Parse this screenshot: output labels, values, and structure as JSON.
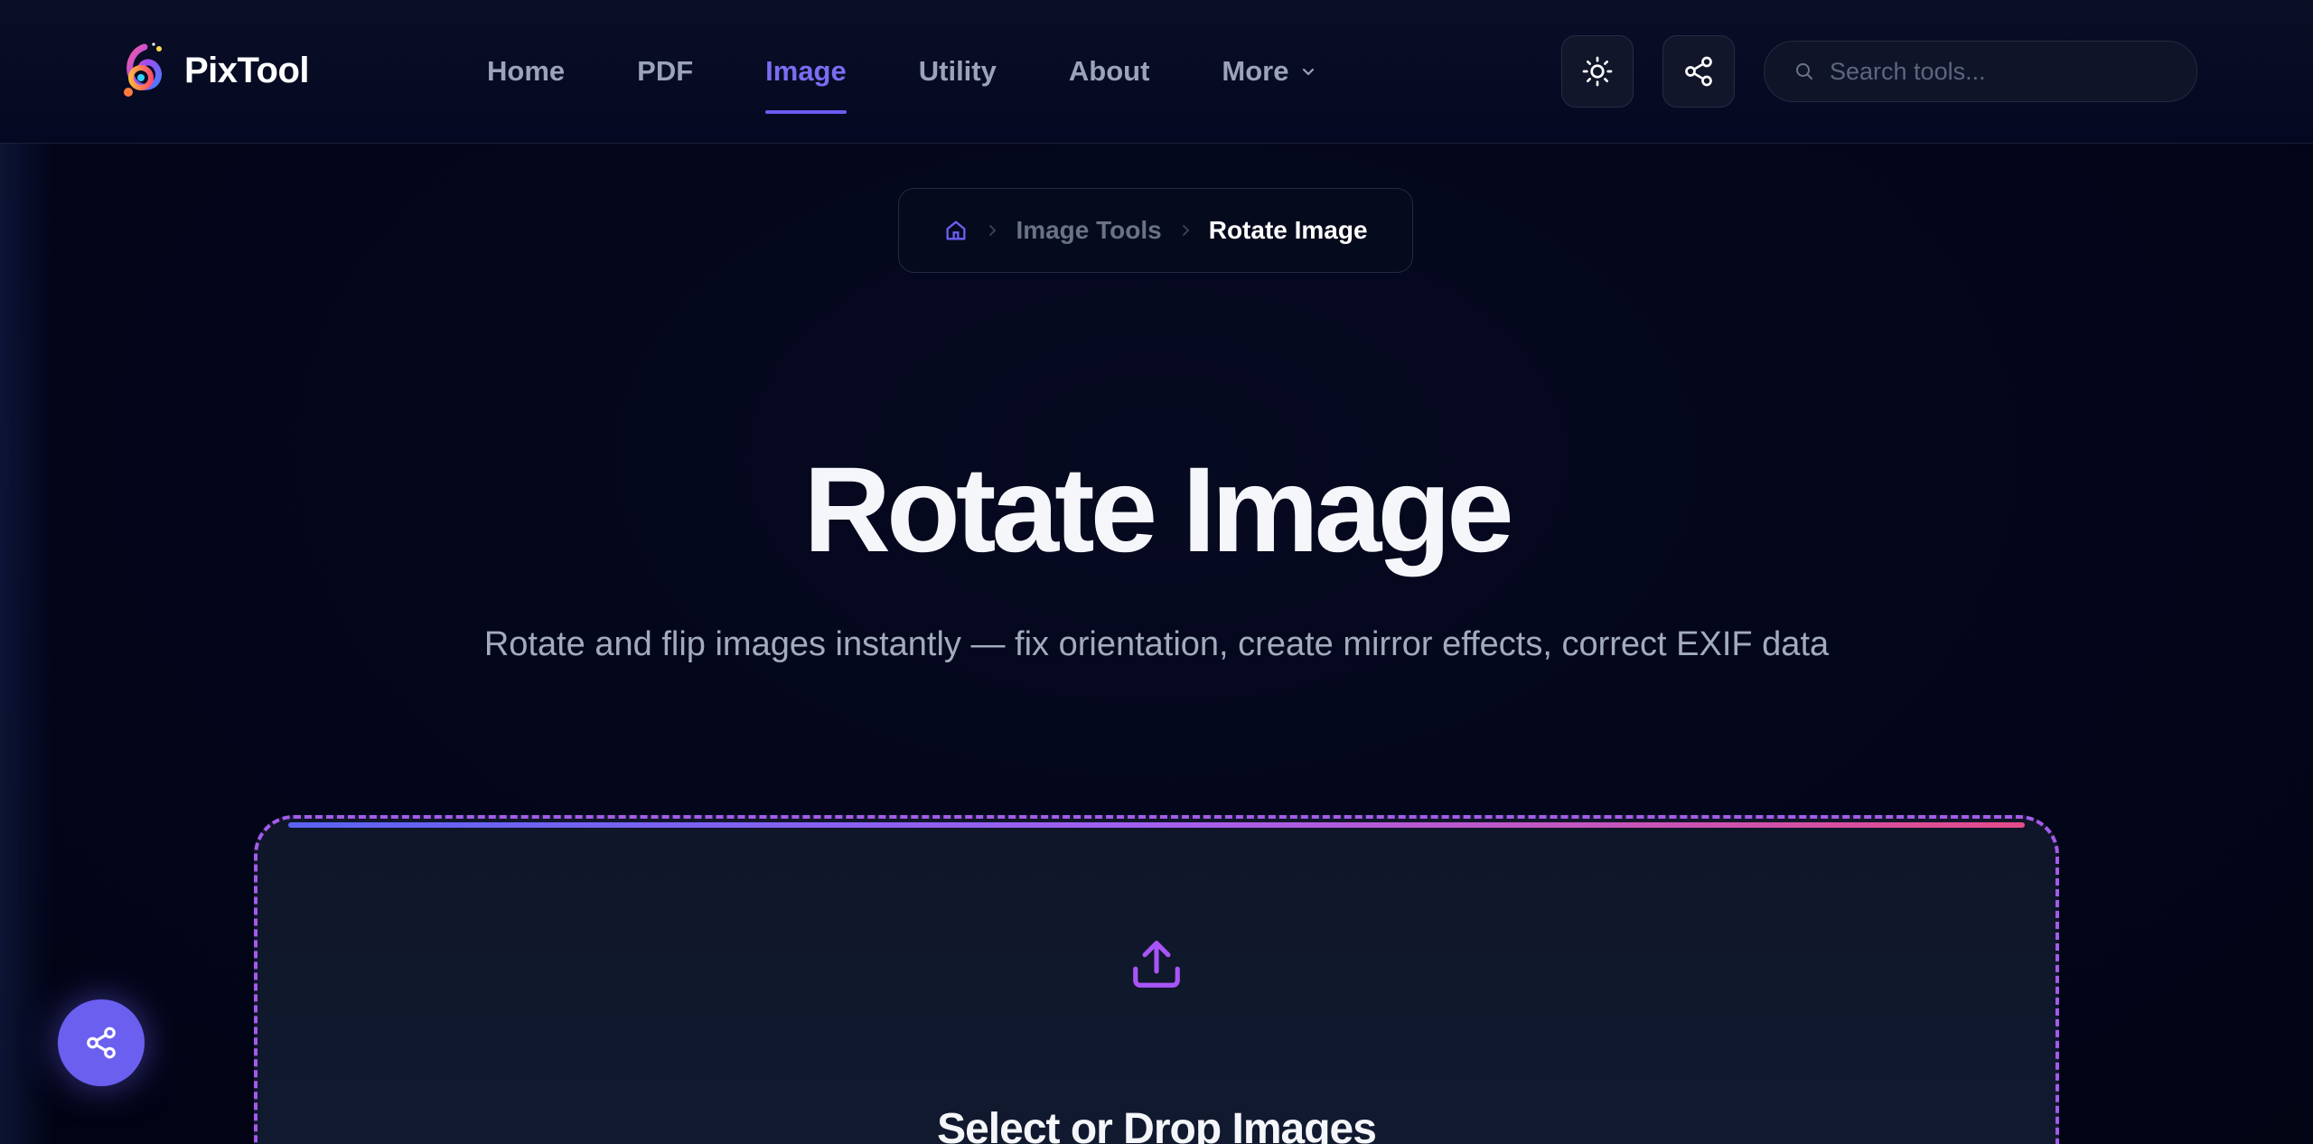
{
  "brand": {
    "name": "PixTool"
  },
  "nav": {
    "items": [
      {
        "label": "Home",
        "active": false
      },
      {
        "label": "PDF",
        "active": false
      },
      {
        "label": "Image",
        "active": true
      },
      {
        "label": "Utility",
        "active": false
      },
      {
        "label": "About",
        "active": false
      },
      {
        "label": "More",
        "active": false,
        "has_dropdown": true
      }
    ]
  },
  "header": {
    "theme_toggle_icon": "sun-icon",
    "share_icon": "share-icon",
    "search_placeholder": "Search tools..."
  },
  "breadcrumb": {
    "home_icon": "home-icon",
    "parent": "Image Tools",
    "current": "Rotate Image"
  },
  "hero": {
    "title": "Rotate Image",
    "subtitle": "Rotate and flip images instantly — fix orientation, create mirror effects, correct EXIF data"
  },
  "dropzone": {
    "icon": "upload-icon",
    "title": "Select or Drop Images"
  },
  "colors": {
    "accent": "#6b5ff0",
    "active_nav": "#7c6cf2",
    "dropzone_border": "#a45bea",
    "background": "#03061a"
  }
}
